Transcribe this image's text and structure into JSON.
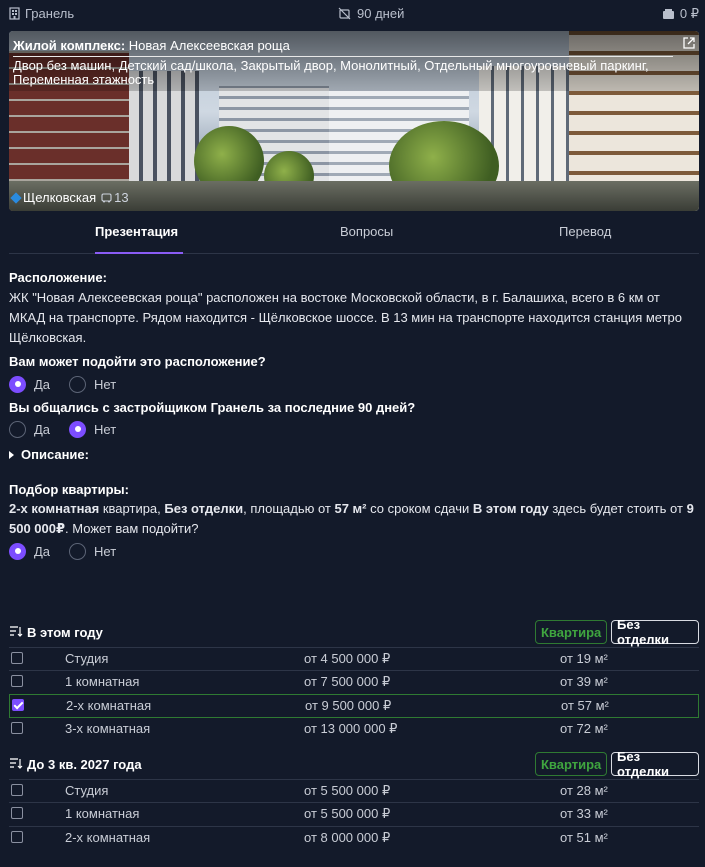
{
  "topbar": {
    "developer": "Гранель",
    "days": "90 дней",
    "money": "0 ₽"
  },
  "hero": {
    "title_label": "Жилой комплекс:",
    "title_value": "Новая Алексеевская роща",
    "features": "Двор без машин, Детский сад/школа, Закрытый двор, Монолитный, Отдельный многоуровневый паркинг, Переменная этажность",
    "metro": "Щелковская",
    "metro_time": "13"
  },
  "tabs": [
    "Презентация",
    "Вопросы",
    "Перевод"
  ],
  "location": {
    "heading": "Расположение:",
    "text": "ЖК \"Новая Алексеевская роща\" расположен на востоке Московской области, в г. Балашиха, всего в 6 км от МКАД на транспорте. Рядом находится - Щёлковское шоссе. В 13 мин на транспорте находится станция метро Щёлковская."
  },
  "q1": {
    "question": "Вам может подойти это расположение?",
    "yes": "Да",
    "no": "Нет"
  },
  "q2": {
    "question": "Вы общались с застройщиком Гранель за последние 90 дней?",
    "yes": "Да",
    "no": "Нет"
  },
  "description": {
    "label": "Описание:"
  },
  "apartment": {
    "heading": "Подбор квартиры:",
    "t1": "2-х комнатная",
    "t2": " квартира, ",
    "t3": "Без отделки",
    "t4": ", площадью от ",
    "t5": "57 м²",
    "t6": " со сроком сдачи ",
    "t7": "В этом году",
    "t8": " здесь будет стоить от ",
    "t9": "9 500 000₽",
    "t10": ". Может вам подойти?",
    "yes": "Да",
    "no": "Нет"
  },
  "sections": [
    {
      "name": "В этом году",
      "btn_type": "Квартира",
      "btn_finish": "Без отделки",
      "rows": [
        {
          "type": "Студия",
          "price": "от 4 500 000 ₽",
          "area": "от 19 м²",
          "checked": false
        },
        {
          "type": "1 комнатная",
          "price": "от 7 500 000 ₽",
          "area": "от 39 м²",
          "checked": false
        },
        {
          "type": "2-х комнатная",
          "price": "от 9 500 000 ₽",
          "area": "от 57 м²",
          "checked": true
        },
        {
          "type": "3-х комнатная",
          "price": "от 13 000 000 ₽",
          "area": "от 72 м²",
          "checked": false
        }
      ]
    },
    {
      "name": "До 3 кв. 2027 года",
      "btn_type": "Квартира",
      "btn_finish": "Без отделки",
      "rows": [
        {
          "type": "Студия",
          "price": "от 5 500 000 ₽",
          "area": "от 28 м²",
          "checked": false
        },
        {
          "type": "1 комнатная",
          "price": "от 5 500 000 ₽",
          "area": "от 33 м²",
          "checked": false
        },
        {
          "type": "2-х комнатная",
          "price": "от 8 000 000 ₽",
          "area": "от 51 м²",
          "checked": false
        }
      ]
    }
  ],
  "colors": {
    "background": "#131a2a",
    "accent": "#7c4dff",
    "green": "#3fa53f",
    "border": "#2d3547"
  }
}
